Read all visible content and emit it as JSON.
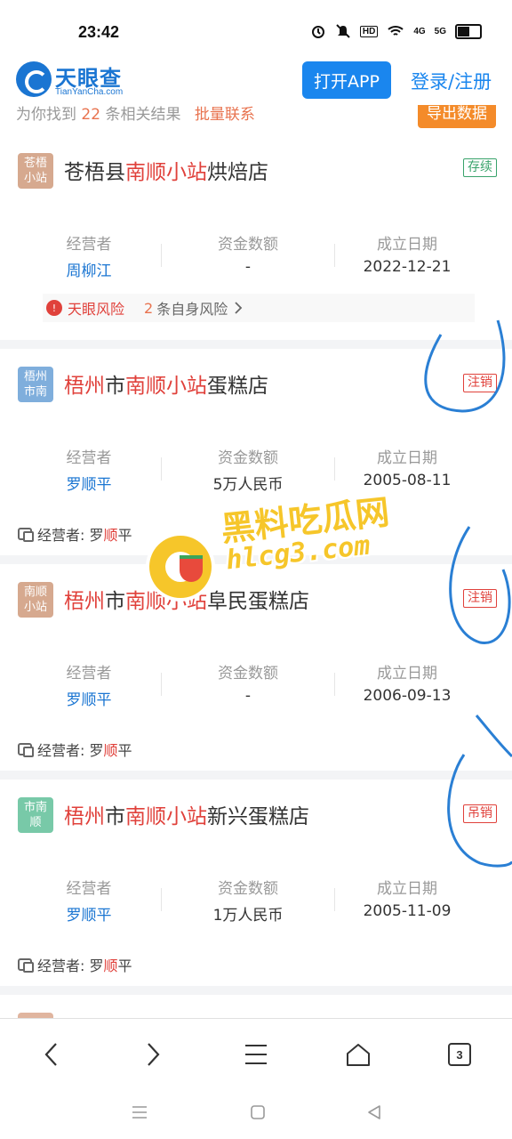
{
  "status_bar": {
    "time": "23:42",
    "network_labels": [
      "HD",
      "4G",
      "5G"
    ]
  },
  "header": {
    "logo_cn": "天眼查",
    "logo_en": "TianYanCha.com",
    "open_app": "打开APP",
    "login": "登录/注册"
  },
  "info_bar": {
    "prefix": "为你找到",
    "count": "22",
    "suffix": "条相关结果",
    "batch": "批量联系",
    "export": "导出数据"
  },
  "columns": {
    "operator": "经营者",
    "capital": "资金数额",
    "date": "成立日期"
  },
  "cards": [
    {
      "avatar": "苍梧\n小站",
      "avatar_color": "#d6a98f",
      "title_pre": "苍梧县",
      "title_hl": "南顺小站",
      "title_post": "烘焙店",
      "status": "存续",
      "operator": "周柳江",
      "capital": "-",
      "date": "2022-12-21",
      "risk_label": "天眼风险",
      "risk_count": "2",
      "risk_text": "条自身风险"
    },
    {
      "avatar": "梧州\n市南",
      "avatar_color": "#7faedc",
      "title_hl1": "梧州",
      "title_mid": "市",
      "title_hl": "南顺小站",
      "title_post": "蛋糕店",
      "status": "注销",
      "operator": "罗顺平",
      "capital": "5万人民币",
      "date": "2005-08-11",
      "op_label": "经营者:",
      "op_pre": "罗",
      "op_hl": "顺",
      "op_post": "平"
    },
    {
      "avatar": "南顺\n小站",
      "avatar_color": "#d6a98f",
      "title_hl1": "梧州",
      "title_mid": "市",
      "title_hl": "南顺小站",
      "title_post": "阜民蛋糕店",
      "status": "注销",
      "operator": "罗顺平",
      "capital": "-",
      "date": "2006-09-13",
      "op_label": "经营者:",
      "op_pre": "罗",
      "op_hl": "顺",
      "op_post": "平"
    },
    {
      "avatar": "市南\n顺",
      "avatar_color": "#78c9a8",
      "title_hl1": "梧州",
      "title_mid": "市",
      "title_hl": "南顺小站",
      "title_post": "新兴蛋糕店",
      "status": "吊销",
      "operator": "罗顺平",
      "capital": "1万人民币",
      "date": "2005-11-09",
      "op_label": "经营者:",
      "op_pre": "罗",
      "op_hl": "顺",
      "op_post": "平"
    }
  ],
  "watermark": {
    "cn": "黑料吃瓜网",
    "url": "hlcg3.com"
  },
  "browser_toolbar": {
    "icons": [
      "back-icon",
      "forward-icon",
      "menu-icon",
      "home-icon",
      "tabs-icon"
    ],
    "tabs_count": "3"
  },
  "system_nav": {
    "icons": [
      "recents-icon",
      "home-icon",
      "back-icon"
    ]
  },
  "colors": {
    "brand_blue": "#1a86ee",
    "highlight_red": "#e0413b",
    "annotation_blue": "#2a7fd4"
  }
}
